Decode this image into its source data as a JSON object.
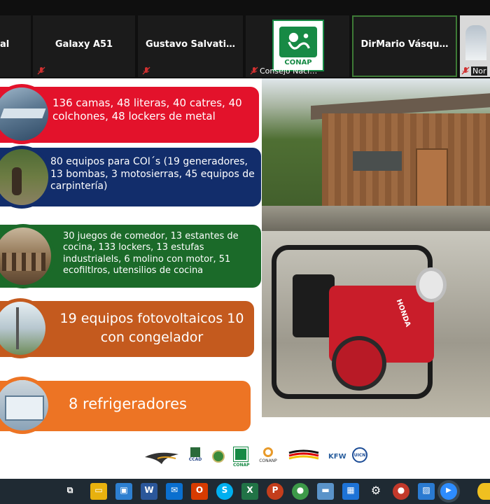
{
  "meeting": {
    "participants": [
      {
        "name": "al",
        "muted": true
      },
      {
        "name": "Galaxy A51",
        "muted": true
      },
      {
        "name": "Gustavo  Salvati…",
        "muted": true
      },
      {
        "name": "Consejo Naci…",
        "logo_text": "CONAP",
        "muted": true
      },
      {
        "name": "DirMario  Vásqu…",
        "muted": false
      },
      {
        "name": "Nor",
        "muted": true
      }
    ]
  },
  "slide": {
    "items": [
      {
        "text": "136 camas, 48 literas, 40 catres, 40 colchones, 48 lockers de metal",
        "color": "#e3122b"
      },
      {
        "text": "80 equipos para COI´s (19 generadores, 13 bombas, 3 motosierras, 45 equipos de carpintería)",
        "color": "#122d6b"
      },
      {
        "text": "30 juegos de comedor, 13 estantes de cocina, 133 lockers, 13 estufas industrialels, 6 molino con motor, 51 ecofiltlros,  utensilios de cocina",
        "color": "#1b6a29"
      },
      {
        "text": "19 equipos fotovoltaicos 10 con congelador",
        "color": "#c45a1e"
      },
      {
        "text": "8 refrigeradores",
        "color": "#ed7424"
      }
    ],
    "logos": [
      "CCAD",
      "CONAP",
      "CONANP",
      "KFW",
      "UICN"
    ],
    "pump_brand": "HONDA"
  },
  "taskbar": {
    "apps": [
      {
        "icon": "task-view-icon",
        "glyph": "⧉",
        "color": "#1f2a33"
      },
      {
        "icon": "file-explorer-icon",
        "glyph": "▭",
        "color": "#e8b10e"
      },
      {
        "icon": "store-icon",
        "glyph": "▣",
        "color": "#2d7fd0"
      },
      {
        "icon": "word-icon",
        "glyph": "W",
        "color": "#2b579a"
      },
      {
        "icon": "mail-icon",
        "glyph": "✉",
        "color": "#0a6fcf"
      },
      {
        "icon": "office-icon",
        "glyph": "O",
        "color": "#d83b01"
      },
      {
        "icon": "skype-icon",
        "glyph": "S",
        "color": "#00aff0"
      },
      {
        "icon": "excel-icon",
        "glyph": "X",
        "color": "#217346"
      },
      {
        "icon": "powerpoint-icon",
        "glyph": "P",
        "color": "#c43e1c"
      },
      {
        "icon": "chrome-icon",
        "glyph": "●",
        "color": "#3d9a49"
      },
      {
        "icon": "laptop-icon",
        "glyph": "▬",
        "color": "#5a93c9"
      },
      {
        "icon": "calendar-icon",
        "glyph": "▦",
        "color": "#1e73d6"
      },
      {
        "icon": "settings-icon",
        "glyph": "⚙",
        "color": "#1f2a33"
      },
      {
        "icon": "chrome-profile-icon",
        "glyph": "●",
        "color": "#c3392b"
      },
      {
        "icon": "photos-icon",
        "glyph": "▨",
        "color": "#2a7ad1"
      },
      {
        "icon": "zoom-icon",
        "glyph": "▶",
        "color": "#2d8cff"
      },
      {
        "icon": "notification-icon",
        "glyph": "●",
        "color": "#f0c020"
      }
    ]
  }
}
